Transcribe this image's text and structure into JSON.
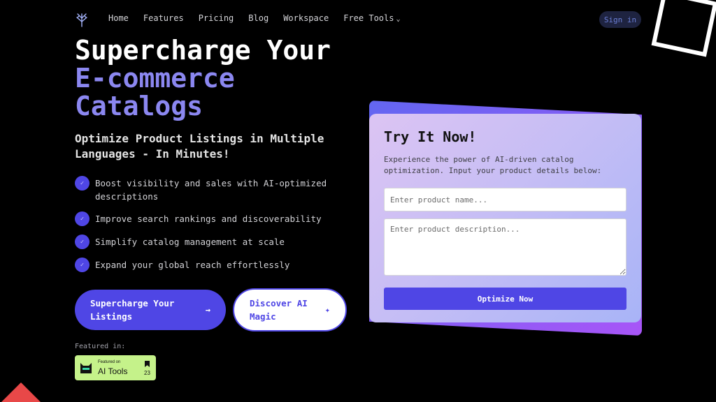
{
  "nav": {
    "logo_icon": "tree-logo-icon",
    "links": [
      "Home",
      "Features",
      "Pricing",
      "Blog",
      "Workspace"
    ],
    "free_tools": "Free Tools",
    "dropdown_icon": "chevron-down-icon",
    "sign_in": "Sign in"
  },
  "hero": {
    "title_line1": "Supercharge Your",
    "title_line2": "E-commerce",
    "title_line3": "Catalogs",
    "subtitle": "Optimize Product Listings in Multiple Languages - In Minutes!",
    "features": [
      "Boost visibility and sales with AI-optimized descriptions",
      "Improve search rankings and discoverability",
      "Simplify catalog management at scale",
      "Expand your global reach effortlessly"
    ],
    "feature_icon": "check-icon",
    "primary_button": "Supercharge Your Listings",
    "primary_arrow": "→",
    "secondary_button": "Discover AI Magic",
    "secondary_icon": "sparkle-icon",
    "featured_label": "Featured in:"
  },
  "badge": {
    "small_text": "Featured on",
    "big_text": "AI Tools",
    "count": "23"
  },
  "form": {
    "title": "Try It Now!",
    "description": "Experience the power of AI-driven catalog optimization. Input your product details below:",
    "name_placeholder": "Enter product name...",
    "description_placeholder": "Enter product description...",
    "submit": "Optimize Now"
  },
  "colors": {
    "accent": "#4f46e5",
    "accent_light": "#8b87f0",
    "badge_green": "#c5f28a",
    "triangle_red": "#e84848"
  }
}
